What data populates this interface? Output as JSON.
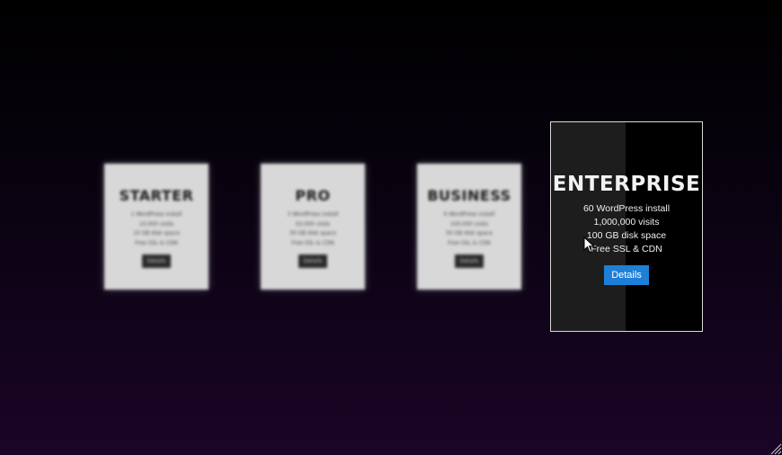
{
  "plans": [
    {
      "name": "STARTER",
      "features": [
        "1 WordPress install",
        "10,000 visits",
        "10 GB disk space",
        "Free SSL & CDN"
      ],
      "button": "Details"
    },
    {
      "name": "PRO",
      "features": [
        "3 WordPress install",
        "50,000 visits",
        "30 GB disk space",
        "Free SSL & CDN"
      ],
      "button": "Details"
    },
    {
      "name": "BUSINESS",
      "features": [
        "6 WordPress install",
        "100,000 visits",
        "50 GB disk space",
        "Free SSL & CDN"
      ],
      "button": "Details"
    },
    {
      "name": "ENTERPRISE",
      "features": [
        "60 WordPress install",
        "1,000,000 visits",
        "100 GB disk space",
        "Free SSL & CDN"
      ],
      "button": "Details"
    }
  ],
  "colors": {
    "accent": "#1e7fd6",
    "background_bottom": "#1a0526"
  },
  "icons": {
    "cursor": "mouse-pointer-icon",
    "corner": "resize-grip-icon"
  }
}
